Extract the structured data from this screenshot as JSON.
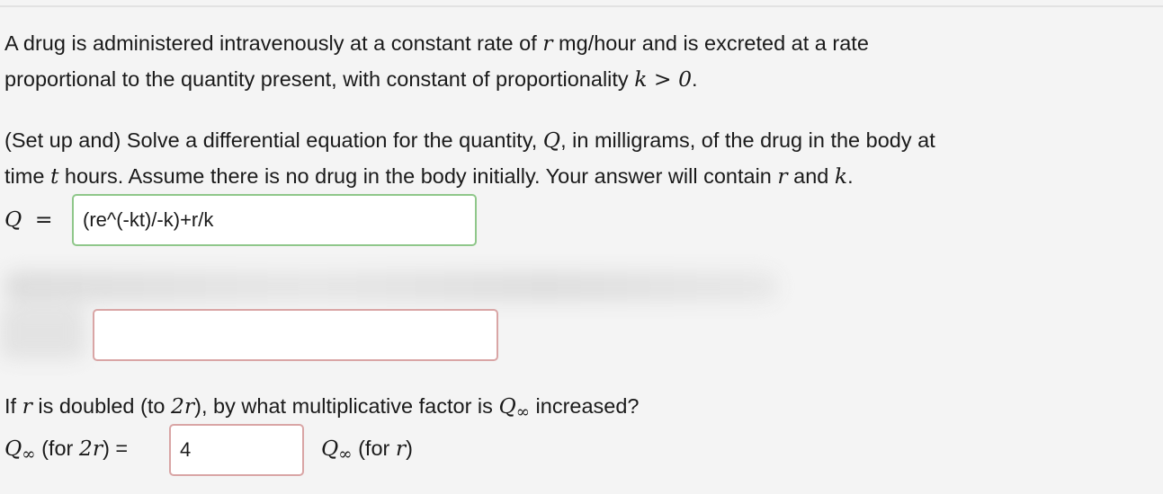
{
  "problem": {
    "intro_part1": "A drug is administered intravenously at a constant rate of",
    "intro_var_r": "r",
    "intro_part2": "mg/hour and is excreted at a rate",
    "intro_line2": "proportional to the quantity present, with constant of proportionality",
    "intro_cond": "k > 0",
    "intro_end": "."
  },
  "part_a": {
    "text1": "(Set up and) Solve a differential equation for the quantity,",
    "var_q": "Q",
    "text2": ", in milligrams, of the drug in the body at",
    "text3": "time",
    "var_t": "t",
    "text4": "hours. Assume there is no drug in the body initially. Your answer will contain",
    "var_r": "r",
    "text5": "and",
    "var_k": "k",
    "text6": ".",
    "label_q": "Q",
    "label_eq": "=",
    "answer": "(re^(-kt)/-k)+r/k",
    "answer_status": "correct"
  },
  "part_b": {
    "answer": "",
    "answer_status": "incorrect",
    "obscured": true
  },
  "part_c": {
    "text1": "If",
    "var_r": "r",
    "text2": "is doubled (to",
    "var_2r": "2r",
    "text3": "), by what multiplicative factor is",
    "var_q": "Q",
    "sub_inf": "∞",
    "text4": "increased?",
    "lhs_q": "Q",
    "lhs_sub": "∞",
    "lhs_for": "(for",
    "lhs_2r": "2r",
    "lhs_close": ") =",
    "answer": "4",
    "rhs_q": "Q",
    "rhs_sub": "∞",
    "rhs_for": "(for",
    "rhs_r": "r",
    "rhs_close": ")"
  },
  "colors": {
    "correct_border": "#8fc78a",
    "incorrect_border": "#d9a5a5",
    "background": "#f4f4f4"
  }
}
